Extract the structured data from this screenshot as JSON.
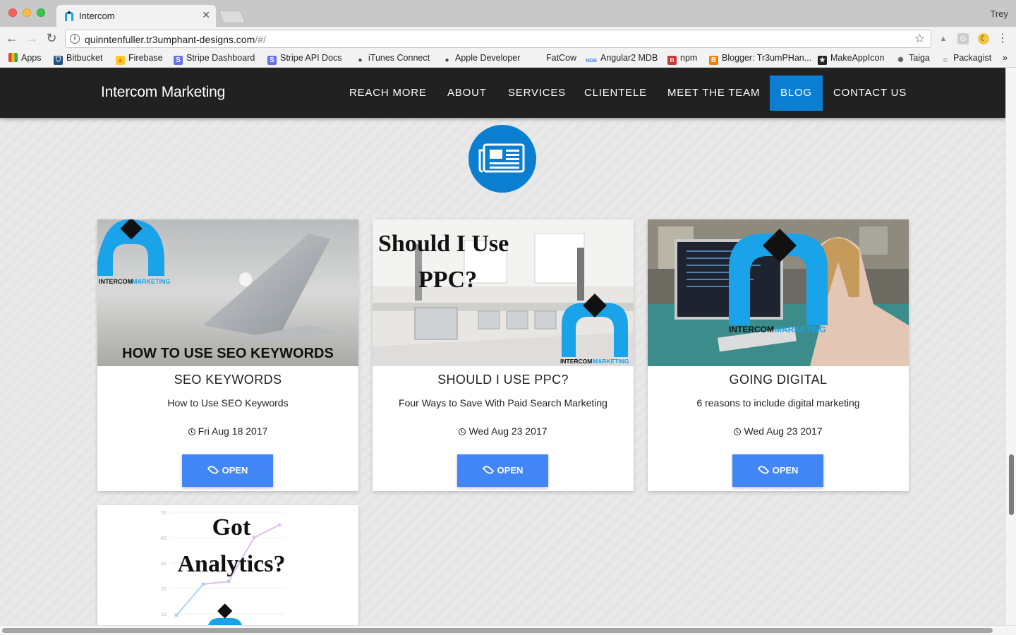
{
  "browser": {
    "tab_title": "Intercom",
    "profile_name": "Trey",
    "url_host": "quinntenfuller.tr3umphant-designs.com",
    "url_path": "/#/",
    "bookmarks": [
      "Apps",
      "Bitbucket",
      "Firebase",
      "Stripe Dashboard",
      "Stripe API Docs",
      "iTunes Connect",
      "Apple Developer",
      "FatCow",
      "Angular2 MDB",
      "npm",
      "Blogger: Tr3umPHan...",
      "MakeAppIcon",
      "Taiga",
      "Packagist"
    ],
    "overflow_label": "»"
  },
  "navbar": {
    "brand": "Intercom Marketing",
    "links": [
      "REACH MORE",
      "ABOUT",
      "SERVICES",
      "CLIENTELE",
      "MEET THE TEAM",
      "BLOG",
      "CONTACT US"
    ],
    "active": "BLOG"
  },
  "posts": [
    {
      "image_caption": "HOW TO USE SEO KEYWORDS",
      "logo_text_a": "INTERCOM",
      "logo_text_b": "MARKETING",
      "title": "SEO KEYWORDS",
      "subtitle": "How to Use SEO Keywords",
      "date": "Fri Aug 18 2017",
      "button": "OPEN"
    },
    {
      "image_caption_line1": "Should I Use",
      "image_caption_line2": "PPC?",
      "logo_text_a": "INTERCOM",
      "logo_text_b": "MARKETING",
      "title": "SHOULD I USE PPC?",
      "subtitle": "Four Ways to Save With Paid Search Marketing",
      "date": "Wed Aug 23 2017",
      "button": "OPEN"
    },
    {
      "logo_text_a": "INTERCOM",
      "logo_text_b": "MARKETING",
      "title": "GOING DIGITAL",
      "subtitle": "6 reasons to include digital marketing",
      "date": "Wed Aug 23 2017",
      "button": "OPEN"
    },
    {
      "image_caption_line1": "Got",
      "image_caption_line2": "Analytics?",
      "axis_ticks": [
        "50",
        "40",
        "30",
        "20",
        "10"
      ]
    }
  ],
  "colors": {
    "navbar_bg": "#212121",
    "accent_blue": "#0a7fd2",
    "button_blue": "#4285f4",
    "logo_blue": "#1aa3e8"
  }
}
